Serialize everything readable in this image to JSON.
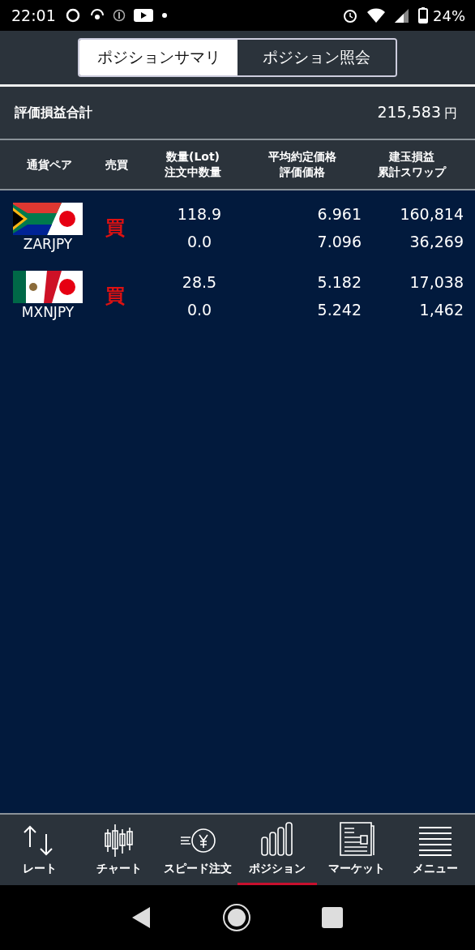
{
  "status_bar": {
    "time": "22:01",
    "battery": "24%"
  },
  "tabs": [
    {
      "label": "ポジションサマリ",
      "selected": true
    },
    {
      "label": "ポジション照会",
      "selected": false
    }
  ],
  "summary": {
    "label": "評価損益合計",
    "value": "215,583",
    "unit": "円"
  },
  "table": {
    "columns": [
      [
        "通貨ペア"
      ],
      [
        "売買"
      ],
      [
        "数量(Lot)",
        "注文中数量"
      ],
      [
        "平均約定価格",
        "評価価格"
      ],
      [
        "建玉損益",
        "累計スワップ"
      ]
    ],
    "rows": [
      {
        "kind": "zar",
        "pair": "ZARJPY",
        "side": "買",
        "quantity": "118.9",
        "pending": "0.0",
        "avg_price": "6.961",
        "eval_price": "7.096",
        "pl": "160,814",
        "swap": "36,269"
      },
      {
        "kind": "mxn",
        "pair": "MXNJPY",
        "side": "買",
        "quantity": "28.5",
        "pending": "0.0",
        "avg_price": "5.182",
        "eval_price": "5.242",
        "pl": "17,038",
        "swap": "1,462"
      }
    ]
  },
  "nav": [
    {
      "kind": "rate",
      "label": "レート",
      "selected": false
    },
    {
      "kind": "chart",
      "label": "チャート",
      "selected": false
    },
    {
      "kind": "speed",
      "label": "スピード注文",
      "selected": false
    },
    {
      "kind": "position",
      "label": "ポジション",
      "selected": true
    },
    {
      "kind": "market",
      "label": "マーケット",
      "selected": false
    },
    {
      "kind": "menu",
      "label": "メニュー",
      "selected": false
    }
  ]
}
